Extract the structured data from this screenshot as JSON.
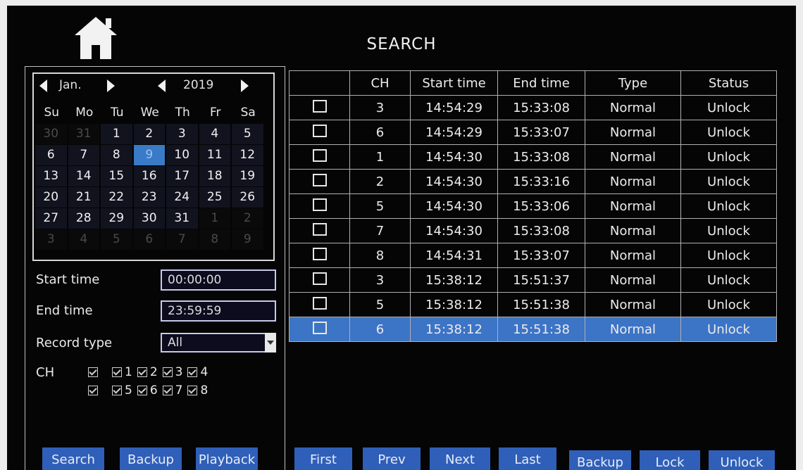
{
  "header": {
    "title": "SEARCH",
    "home_icon": "home-icon"
  },
  "calendar": {
    "month": "Jan.",
    "year": "2019",
    "weekdays": [
      "Su",
      "Mo",
      "Tu",
      "We",
      "Th",
      "Fr",
      "Sa"
    ],
    "days": [
      {
        "d": "30",
        "o": true
      },
      {
        "d": "31",
        "o": true
      },
      {
        "d": "1"
      },
      {
        "d": "2"
      },
      {
        "d": "3"
      },
      {
        "d": "4"
      },
      {
        "d": "5"
      },
      {
        "d": "6"
      },
      {
        "d": "7"
      },
      {
        "d": "8"
      },
      {
        "d": "9",
        "sel": true
      },
      {
        "d": "10"
      },
      {
        "d": "11"
      },
      {
        "d": "12"
      },
      {
        "d": "13"
      },
      {
        "d": "14"
      },
      {
        "d": "15"
      },
      {
        "d": "16"
      },
      {
        "d": "17"
      },
      {
        "d": "18"
      },
      {
        "d": "19"
      },
      {
        "d": "20"
      },
      {
        "d": "21"
      },
      {
        "d": "22"
      },
      {
        "d": "23"
      },
      {
        "d": "24"
      },
      {
        "d": "25"
      },
      {
        "d": "26"
      },
      {
        "d": "27"
      },
      {
        "d": "28"
      },
      {
        "d": "29"
      },
      {
        "d": "30"
      },
      {
        "d": "31"
      },
      {
        "d": "1",
        "o": true
      },
      {
        "d": "2",
        "o": true
      },
      {
        "d": "3",
        "o": true
      },
      {
        "d": "4",
        "o": true
      },
      {
        "d": "5",
        "o": true
      },
      {
        "d": "6",
        "o": true
      },
      {
        "d": "7",
        "o": true
      },
      {
        "d": "8",
        "o": true
      },
      {
        "d": "9",
        "o": true
      }
    ]
  },
  "filters": {
    "start_label": "Start time",
    "start_value": "00:00:00",
    "end_label": "End time",
    "end_value": "23:59:59",
    "record_label": "Record type",
    "record_value": "All",
    "ch_label": "CH",
    "ch_row1": [
      "",
      "1",
      "2",
      "3",
      "4"
    ],
    "ch_row2": [
      "",
      "5",
      "6",
      "7",
      "8"
    ]
  },
  "left_buttons": [
    "Search",
    "Backup",
    "Playback"
  ],
  "table": {
    "columns": [
      "",
      "CH",
      "Start time",
      "End time",
      "Type",
      "Status"
    ],
    "rows": [
      [
        "3",
        "14:54:29",
        "15:33:08",
        "Normal",
        "Unlock"
      ],
      [
        "6",
        "14:54:29",
        "15:33:07",
        "Normal",
        "Unlock"
      ],
      [
        "1",
        "14:54:30",
        "15:33:08",
        "Normal",
        "Unlock"
      ],
      [
        "2",
        "14:54:30",
        "15:33:16",
        "Normal",
        "Unlock"
      ],
      [
        "5",
        "14:54:30",
        "15:33:06",
        "Normal",
        "Unlock"
      ],
      [
        "7",
        "14:54:30",
        "15:33:08",
        "Normal",
        "Unlock"
      ],
      [
        "8",
        "14:54:31",
        "15:33:07",
        "Normal",
        "Unlock"
      ],
      [
        "3",
        "15:38:12",
        "15:51:37",
        "Normal",
        "Unlock"
      ],
      [
        "5",
        "15:38:12",
        "15:51:38",
        "Normal",
        "Unlock"
      ],
      [
        "6",
        "15:38:12",
        "15:51:38",
        "Normal",
        "Unlock"
      ]
    ],
    "selected_row": 9
  },
  "bottom_buttons": [
    "First",
    "Prev",
    "Next",
    "Last",
    "Backup",
    "Lock",
    "Unlock"
  ],
  "colors": {
    "accent": "#3c74c6",
    "background": "#050505"
  }
}
